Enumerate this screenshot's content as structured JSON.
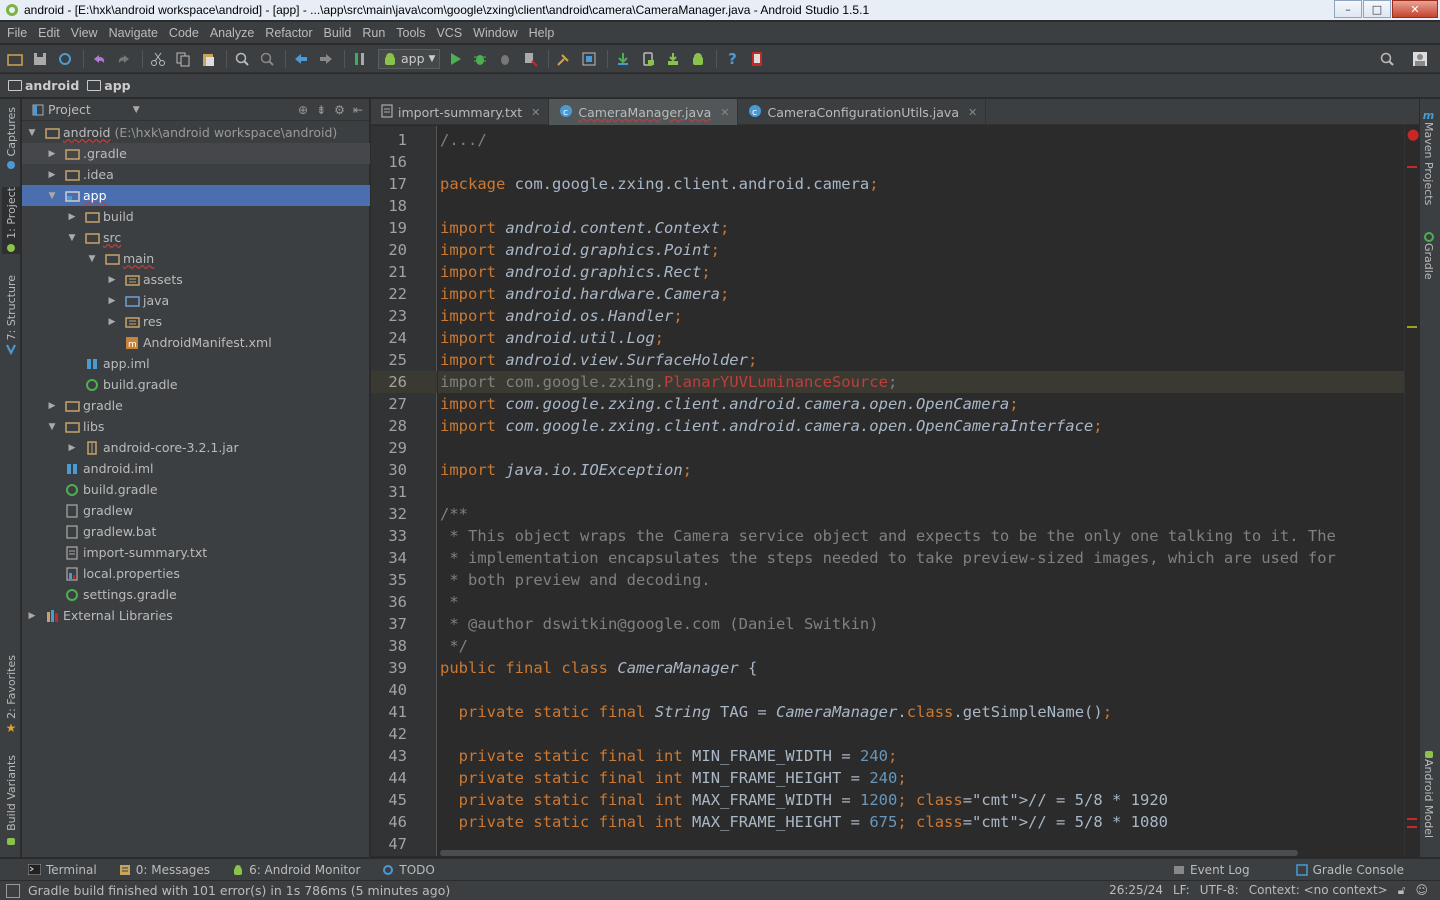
{
  "window": {
    "title": "android - [E:\\hxk\\android workspace\\android] - [app] - ...\\app\\src\\main\\java\\com\\google\\zxing\\client\\android\\camera\\CameraManager.java - Android Studio 1.5.1"
  },
  "menu": [
    "File",
    "Edit",
    "View",
    "Navigate",
    "Code",
    "Analyze",
    "Refactor",
    "Build",
    "Run",
    "Tools",
    "VCS",
    "Window",
    "Help"
  ],
  "toolbar": {
    "run_config": "app"
  },
  "breadcrumb": [
    "android",
    "app"
  ],
  "left_tabs": [
    "Captures",
    "1: Project",
    "7: Structure",
    "2: Favorites",
    "Build Variants"
  ],
  "right_tabs": [
    "Maven Projects",
    "Gradle",
    "Android Model"
  ],
  "project_panel": {
    "title": "Project",
    "tree": [
      {
        "label": "android",
        "suffix": "(E:\\hxk\\android workspace\\android)",
        "icon": "folder-icon",
        "arrow": "down"
      },
      {
        "label": ".gradle",
        "icon": "folder-icon",
        "arrow": "right"
      },
      {
        "label": ".idea",
        "icon": "folder-icon",
        "arrow": "right"
      },
      {
        "label": "app",
        "icon": "module-folder-icon",
        "arrow": "down"
      },
      {
        "label": "build",
        "icon": "folder-icon",
        "arrow": "right"
      },
      {
        "label": "src",
        "icon": "folder-icon",
        "arrow": "down"
      },
      {
        "label": "main",
        "icon": "folder-icon",
        "arrow": "down"
      },
      {
        "label": "assets",
        "icon": "assets-folder-icon",
        "arrow": "right"
      },
      {
        "label": "java",
        "icon": "source-folder-icon",
        "arrow": "right"
      },
      {
        "label": "res",
        "icon": "resource-folder-icon",
        "arrow": "right"
      },
      {
        "label": "AndroidManifest.xml",
        "icon": "manifest-icon",
        "arrow": ""
      },
      {
        "label": "app.iml",
        "icon": "iml-icon",
        "arrow": ""
      },
      {
        "label": "build.gradle",
        "icon": "gradle-icon",
        "arrow": ""
      },
      {
        "label": "gradle",
        "icon": "folder-icon",
        "arrow": "right"
      },
      {
        "label": "libs",
        "icon": "folder-icon",
        "arrow": "down"
      },
      {
        "label": "android-core-3.2.1.jar",
        "icon": "jar-icon",
        "arrow": "right"
      },
      {
        "label": "android.iml",
        "icon": "iml-icon",
        "arrow": ""
      },
      {
        "label": "build.gradle",
        "icon": "gradle-icon",
        "arrow": ""
      },
      {
        "label": "gradlew",
        "icon": "file-icon",
        "arrow": ""
      },
      {
        "label": "gradlew.bat",
        "icon": "file-icon",
        "arrow": ""
      },
      {
        "label": "import-summary.txt",
        "icon": "text-file-icon",
        "arrow": ""
      },
      {
        "label": "local.properties",
        "icon": "properties-icon",
        "arrow": ""
      },
      {
        "label": "settings.gradle",
        "icon": "gradle-icon",
        "arrow": ""
      },
      {
        "label": "External Libraries",
        "icon": "library-icon",
        "arrow": "right"
      }
    ]
  },
  "editor_tabs": [
    {
      "label": "import-summary.txt",
      "active": false
    },
    {
      "label": "CameraManager.java",
      "active": true
    },
    {
      "label": "CameraConfigurationUtils.java",
      "active": false
    }
  ],
  "code_lines": [
    {
      "n": "1",
      "t": "/.../"
    },
    {
      "n": "16",
      "t": ""
    },
    {
      "n": "17",
      "t": "package com.google.zxing.client.android.camera;"
    },
    {
      "n": "18",
      "t": ""
    },
    {
      "n": "19",
      "t": "import android.content.Context;"
    },
    {
      "n": "20",
      "t": "import android.graphics.Point;"
    },
    {
      "n": "21",
      "t": "import android.graphics.Rect;"
    },
    {
      "n": "22",
      "t": "import android.hardware.Camera;"
    },
    {
      "n": "23",
      "t": "import android.os.Handler;"
    },
    {
      "n": "24",
      "t": "import android.util.Log;"
    },
    {
      "n": "25",
      "t": "import android.view.SurfaceHolder;"
    },
    {
      "n": "26",
      "t": "import com.google.zxing.PlanarYUVLuminanceSource;"
    },
    {
      "n": "27",
      "t": "import com.google.zxing.client.android.camera.open.OpenCamera;"
    },
    {
      "n": "28",
      "t": "import com.google.zxing.client.android.camera.open.OpenCameraInterface;"
    },
    {
      "n": "29",
      "t": ""
    },
    {
      "n": "30",
      "t": "import java.io.IOException;"
    },
    {
      "n": "31",
      "t": ""
    },
    {
      "n": "32",
      "t": "/**"
    },
    {
      "n": "33",
      "t": " * This object wraps the Camera service object and expects to be the only one talking to it. The"
    },
    {
      "n": "34",
      "t": " * implementation encapsulates the steps needed to take preview-sized images, which are used for"
    },
    {
      "n": "35",
      "t": " * both preview and decoding."
    },
    {
      "n": "36",
      "t": " *"
    },
    {
      "n": "37",
      "t": " * @author dswitkin@google.com (Daniel Switkin)"
    },
    {
      "n": "38",
      "t": " */"
    },
    {
      "n": "39",
      "t": "public final class CameraManager {"
    },
    {
      "n": "40",
      "t": ""
    },
    {
      "n": "41",
      "t": "  private static final String TAG = CameraManager.class.getSimpleName();"
    },
    {
      "n": "42",
      "t": ""
    },
    {
      "n": "43",
      "t": "  private static final int MIN_FRAME_WIDTH = 240;"
    },
    {
      "n": "44",
      "t": "  private static final int MIN_FRAME_HEIGHT = 240;"
    },
    {
      "n": "45",
      "t": "  private static final int MAX_FRAME_WIDTH = 1200; // = 5/8 * 1920"
    },
    {
      "n": "46",
      "t": "  private static final int MAX_FRAME_HEIGHT = 675; // = 5/8 * 1080"
    },
    {
      "n": "47",
      "t": ""
    }
  ],
  "bottom_tabs": [
    "Terminal",
    "0: Messages",
    "6: Android Monitor",
    "TODO"
  ],
  "bottom_right_tabs": [
    "Event Log",
    "Gradle Console"
  ],
  "status": {
    "message": "Gradle build finished with 101 error(s) in 1s 786ms (5 minutes ago)",
    "position": "26:25/24",
    "line_sep": "LF:",
    "encoding": "UTF-8:",
    "context": "Context: <no context>"
  },
  "colors": {
    "keyword": "#cc7832",
    "comment": "#808080",
    "number": "#6897bb",
    "error": "#bc3f3c",
    "selection": "#4b6eaf"
  }
}
